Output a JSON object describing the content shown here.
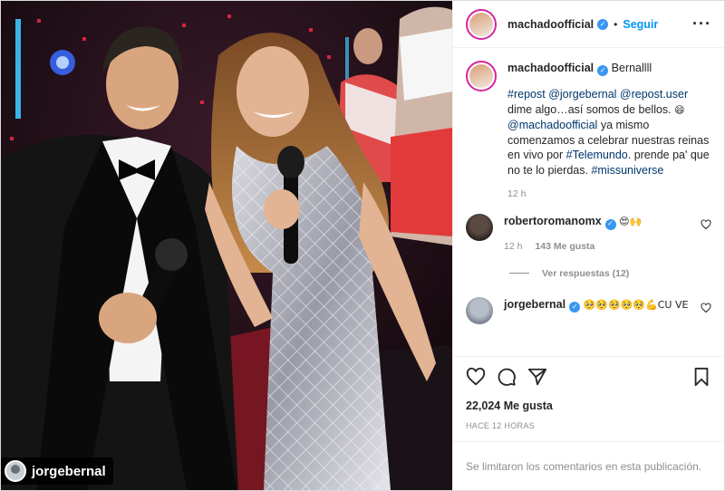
{
  "photo": {
    "tag_username": "jorgebernal"
  },
  "header": {
    "username": "machadoofficial",
    "follow_label": "Seguir",
    "more_icon": "more-horizontal-icon"
  },
  "caption": {
    "username": "machadoofficial",
    "lead_text": "Bernallll",
    "tag_repost": "#repost",
    "tag_jorge": "@jorgebernal",
    "tag_repost_user": "@repost.user",
    "text_1": "dime algo…así somos de bellos.",
    "emoji_1": "😄",
    "tag_machado": "@machadoofficial",
    "text_2": "ya mismo comenzamos a celebrar nuestras reinas en vivo por",
    "tag_telemundo": "#Telemundo",
    "text_3": ". prende pa' que no te lo pierdas.",
    "tag_missuniverse": "#missuniverse",
    "time": "12 h"
  },
  "comments": [
    {
      "username": "robertoromanomx",
      "text": "😍🙌",
      "time": "12 h",
      "likes": "143 Me gusta",
      "replies_label": "Ver respuestas (12)"
    },
    {
      "username": "jorgebernal",
      "text": "🥺🥺🥺🥺🥺💪CU VE"
    }
  ],
  "actions": {
    "like_icon": "heart-icon",
    "comment_icon": "comment-icon",
    "share_icon": "paper-plane-icon",
    "save_icon": "bookmark-icon"
  },
  "stats": {
    "likes": "22,024 Me gusta",
    "time_ago": "HACE 12 HORAS"
  },
  "footer": {
    "comments_limited": "Se limitaron los comentarios en esta publicación."
  },
  "colors": {
    "link_blue": "#0095f6",
    "tag_blue": "#00376b",
    "verified_blue": "#3897f0",
    "muted": "#8e8e8e"
  }
}
